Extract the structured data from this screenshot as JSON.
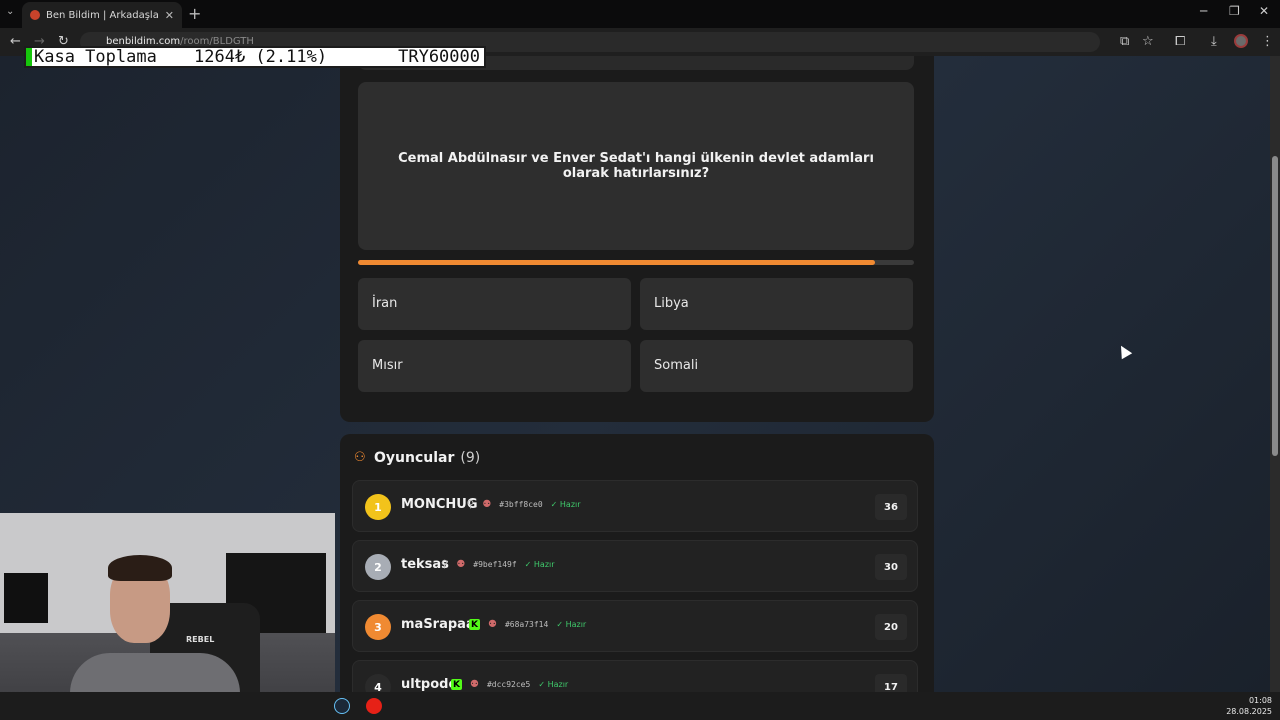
{
  "browser": {
    "tab_title": "Ben Bildim | Arkadaşlarınla Onli",
    "url_host": "benbildim.com",
    "url_path": "/room/BLDGTH"
  },
  "overlay": {
    "label": "Kasa Toplama",
    "value": "1264₺ (2.11%)",
    "goal": "TRY60000",
    "progress_fraction": 0.0211
  },
  "question": {
    "text": "Cemal Abdülnasır ve Enver Sedat'ı hangi ülkenin devlet adamları olarak hatırlarsınız?",
    "timer_fraction": 0.93
  },
  "answers": [
    "İran",
    "Libya",
    "Mısır",
    "Somali"
  ],
  "players": {
    "title": "Oyuncular",
    "count": "(9)",
    "ready_label": "Hazır",
    "list": [
      {
        "rank": "1",
        "name": "MONCHUG",
        "hash": "#3bff8ce0",
        "score": "36",
        "rank_color": "#f2c31b",
        "kick": false
      },
      {
        "rank": "2",
        "name": "teksas",
        "hash": "#9bef149f",
        "score": "30",
        "rank_color": "#a8adb5",
        "kick": false
      },
      {
        "rank": "3",
        "name": "maSrapaa",
        "hash": "#68a73f14",
        "score": "20",
        "rank_color": "#f08a32",
        "kick": true
      },
      {
        "rank": "4",
        "name": "ultpode",
        "hash": "#dcc92ce5",
        "score": "17",
        "rank_color": "#2a2a2a",
        "kick": true
      }
    ]
  },
  "taskbar": {
    "time": "01:08",
    "date": "28.08.2025"
  },
  "webcam": {
    "brand": "REBEL"
  }
}
